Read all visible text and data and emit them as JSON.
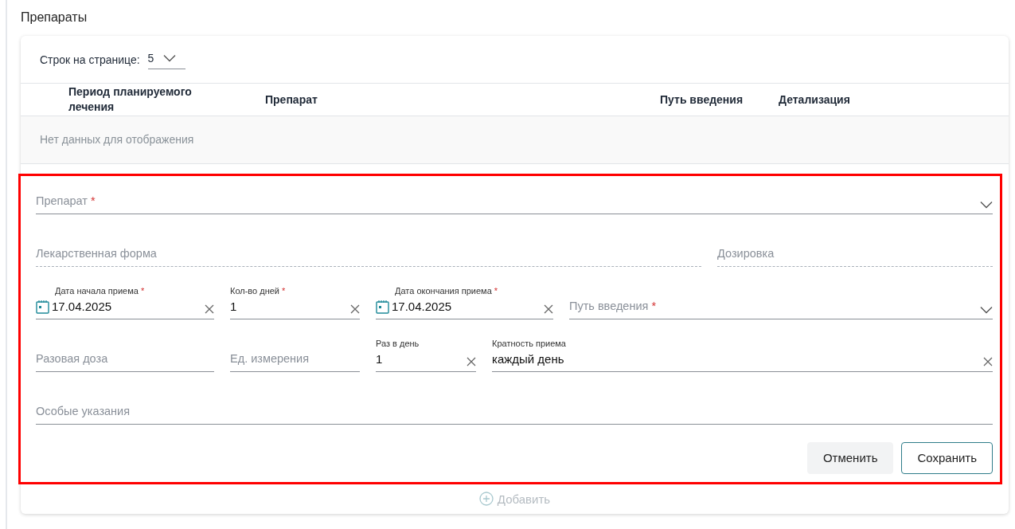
{
  "section_title": "Препараты",
  "pager": {
    "label": "Строк на странице:",
    "value": "5"
  },
  "table": {
    "columns": [
      "Период планируемого лечения",
      "Препарат",
      "Путь введения",
      "Детализация"
    ],
    "empty_text": "Нет данных для отображения"
  },
  "form": {
    "rows": [
      [
        {
          "kind": "select",
          "label": "Препарат",
          "required_mark": "*"
        }
      ],
      [
        {
          "kind": "readonly",
          "label": "Лекарственная форма"
        },
        {
          "kind": "readonly",
          "label": "Дозировка"
        }
      ],
      [
        {
          "kind": "date",
          "label": "Дата начала приема",
          "required_mark": "*",
          "value": "17.04.2025"
        },
        {
          "kind": "text",
          "label": "Кол-во дней",
          "required_mark": "*",
          "value": "1"
        },
        {
          "kind": "date",
          "label": "Дата окончания приема",
          "required_mark": "*",
          "value": "17.04.2025"
        },
        {
          "kind": "select",
          "label": "Путь введения",
          "required_mark": "*"
        }
      ],
      [
        {
          "kind": "text",
          "label": "Разовая доза"
        },
        {
          "kind": "text",
          "label": "Ед. измерения"
        },
        {
          "kind": "text",
          "label": "Раз в день",
          "value": "1"
        },
        {
          "kind": "text",
          "label": "Кратность приема",
          "value": "каждый день"
        }
      ],
      [
        {
          "kind": "text",
          "label": "Особые указания"
        }
      ]
    ],
    "buttons": [
      {
        "label": "Отменить",
        "kind": "secondary"
      },
      {
        "label": "Сохранить",
        "kind": "outline"
      }
    ]
  },
  "add_button": {
    "label": "Добавить",
    "disabled": true
  }
}
